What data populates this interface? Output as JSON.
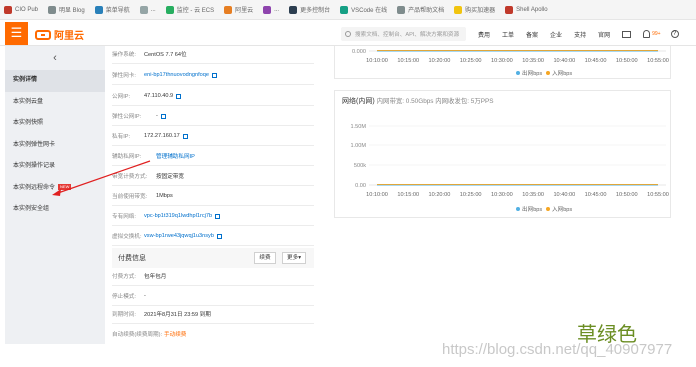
{
  "browser": {
    "bookmarks": [
      {
        "label": "CIO Pub",
        "color": "#c0392b"
      },
      {
        "label": "明显 Blog",
        "color": "#7f8c8d"
      },
      {
        "label": "菜单导航",
        "color": "#2980b9"
      },
      {
        "label": "...",
        "color": "#95a5a6"
      },
      {
        "label": "监控 - 云 ECS",
        "color": "#27ae60"
      },
      {
        "label": "阿里云",
        "color": "#e67e22"
      },
      {
        "label": "...",
        "color": "#8e44ad"
      },
      {
        "label": "更多控制台",
        "color": "#2c3e50"
      },
      {
        "label": "VSCode 在线",
        "color": "#16a085"
      },
      {
        "label": "产品帮助文档",
        "color": "#7f8c8d"
      },
      {
        "label": "购买加速器",
        "color": "#f1c40f"
      },
      {
        "label": "Shell Apollo",
        "color": "#c0392b"
      }
    ]
  },
  "header": {
    "menu_icon": "☰",
    "logo": "阿里云",
    "search_placeholder": "搜索文档、控制台、API、解决方案和资源",
    "nav": [
      "费用",
      "工单",
      "备案",
      "企业",
      "支持",
      "官网"
    ],
    "bell_count": "99+",
    "help": "?"
  },
  "sidebar": {
    "back": "‹",
    "items": [
      {
        "label": "实例详情",
        "active": true
      },
      {
        "label": "本实例云盘"
      },
      {
        "label": "本实例快照"
      },
      {
        "label": "本实例弹性网卡"
      },
      {
        "label": "本实例操作记录"
      },
      {
        "label": "本实例远程命令",
        "badge": "NEW"
      },
      {
        "label": "本实例安全组"
      }
    ]
  },
  "detail": {
    "rows": [
      {
        "label": "操作系统:",
        "value": "CentOS 7.7 64位"
      },
      {
        "label": "弹性网卡:",
        "value": "eni-bp17thnuovodngnfoqe",
        "style": "link",
        "copy": true
      },
      {
        "label": "公网IP:",
        "value": "47.110.40.9",
        "copy": true
      },
      {
        "label": "弹性公网IP:",
        "value": "-",
        "copy": true
      },
      {
        "label": "私有IP:",
        "value": "172.27.160.17",
        "copy": true
      },
      {
        "label": "辅助私网IP:",
        "value": "管理辅助私网IP",
        "style": "link"
      },
      {
        "label": "带宽计费方式:",
        "value": "按固定带宽"
      },
      {
        "label": "当前使用带宽:",
        "value": "1Mbps"
      },
      {
        "label": "专有网络:",
        "value": "vpc-bp1t319q1lwdhpl1rcj7b",
        "style": "link",
        "copy": true
      },
      {
        "label": "虚拟交换机:",
        "value": "vsw-bp1rwe43jqwqj1u3nsyb",
        "style": "link",
        "copy": true
      }
    ],
    "pay": {
      "title": "付费信息",
      "renew": "续费",
      "more": "更多▾",
      "rows": [
        {
          "label": "付费方式:",
          "value": "包年包月"
        },
        {
          "label": "停止模式:",
          "value": "-"
        },
        {
          "label": "到期时间:",
          "value": "2021年8月31日 23:59 到期"
        },
        {
          "label": "自动续费(续费周期):",
          "value": "手动续费",
          "style": "orange"
        }
      ]
    }
  },
  "chart_data": [
    {
      "type": "line",
      "title": "",
      "x": [
        "10:10:00",
        "10:15:00",
        "10:20:00",
        "10:25:00",
        "10:30:00",
        "10:35:00",
        "10:40:00",
        "10:45:00",
        "10:50:00",
        "10:55:00"
      ],
      "ylim": [
        0,
        0
      ],
      "y_ticks": [
        "0.000"
      ],
      "series": [
        {
          "name": "出网bps",
          "color": "#52b0e3",
          "values": [
            0,
            0,
            0,
            0,
            0,
            0,
            0,
            0,
            0,
            0
          ]
        },
        {
          "name": "入网bps",
          "color": "#f5a623",
          "values": [
            0,
            0,
            0,
            0,
            0,
            0,
            0,
            0,
            0,
            0
          ]
        }
      ]
    },
    {
      "type": "line",
      "title": "网络(内网)",
      "subtitle": "内网带宽: 0.50Gbps 内网收发包: 5万PPS",
      "x": [
        "10:10:00",
        "10:15:00",
        "10:20:00",
        "10:25:00",
        "10:30:00",
        "10:35:00",
        "10:40:00",
        "10:45:00",
        "10:50:00",
        "10:55:00"
      ],
      "ylim": [
        0,
        1500000
      ],
      "y_ticks": [
        "1.50M",
        "1.00M",
        "500k",
        "0.00"
      ],
      "series": [
        {
          "name": "出网bps",
          "color": "#52b0e3",
          "values": [
            0,
            0,
            0,
            0,
            0,
            0,
            0,
            0,
            0,
            0
          ]
        },
        {
          "name": "入网bps",
          "color": "#f5a623",
          "values": [
            0,
            0,
            0,
            0,
            0,
            0,
            0,
            0,
            0,
            0
          ]
        }
      ]
    }
  ],
  "annotation": "草绿色",
  "watermark": "https://blog.csdn.net/qq_40907977"
}
